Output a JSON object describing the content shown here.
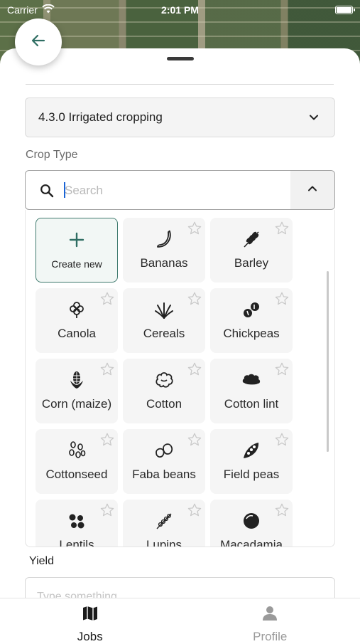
{
  "status_bar": {
    "carrier": "Carrier",
    "time": "2:01 PM"
  },
  "header": {
    "back_icon": "arrow-left-icon"
  },
  "category_select": {
    "value": "4.3.0 Irrigated cropping"
  },
  "crop_type": {
    "label": "Crop Type",
    "search_placeholder": "Search",
    "create_label": "Create new",
    "items": [
      {
        "label": "Bananas",
        "icon": "banana-icon"
      },
      {
        "label": "Barley",
        "icon": "barley-icon"
      },
      {
        "label": "Canola",
        "icon": "canola-icon"
      },
      {
        "label": "Cereals",
        "icon": "cereals-icon"
      },
      {
        "label": "Chickpeas",
        "icon": "chickpeas-icon"
      },
      {
        "label": "Corn (maize)",
        "icon": "corn-icon"
      },
      {
        "label": "Cotton",
        "icon": "cotton-icon"
      },
      {
        "label": "Cotton lint",
        "icon": "cotton-lint-icon"
      },
      {
        "label": "Cottonseed",
        "icon": "cottonseed-icon"
      },
      {
        "label": "Faba beans",
        "icon": "faba-beans-icon"
      },
      {
        "label": "Field peas",
        "icon": "field-peas-icon"
      },
      {
        "label": "Lentils",
        "icon": "lentils-icon"
      },
      {
        "label": "Lupins",
        "icon": "lupins-icon"
      },
      {
        "label": "Macadamia",
        "icon": "macadamia-icon"
      }
    ]
  },
  "yield": {
    "label": "Yield",
    "placeholder": "Type something"
  },
  "nav": {
    "jobs": {
      "label": "Jobs",
      "icon": "map-icon"
    },
    "profile": {
      "label": "Profile",
      "icon": "person-icon"
    }
  }
}
